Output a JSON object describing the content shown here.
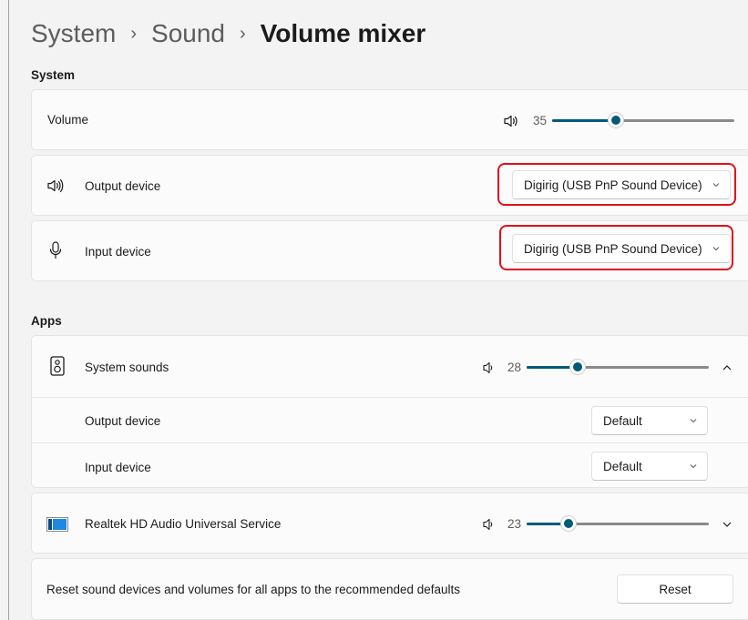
{
  "breadcrumb": {
    "items": [
      "System",
      "Sound"
    ],
    "separator": "›",
    "current": "Volume mixer"
  },
  "system_section": {
    "label": "System",
    "volume": {
      "label": "Volume",
      "value": "35",
      "level": 35,
      "icon": "speaker-icon"
    },
    "output_device": {
      "label": "Output device",
      "selected": "Digirig (USB PnP Sound Device)",
      "icon": "speaker-icon"
    },
    "input_device": {
      "label": "Input device",
      "selected": "Digirig (USB PnP Sound Device)",
      "icon": "microphone-icon"
    }
  },
  "apps_section": {
    "label": "Apps",
    "apps": [
      {
        "name": "System sounds",
        "icon": "system-sounds-icon",
        "volume": "28",
        "level": 28,
        "expanded": true,
        "output_device": {
          "label": "Output device",
          "selected": "Default"
        },
        "input_device": {
          "label": "Input device",
          "selected": "Default"
        }
      },
      {
        "name": "Realtek HD Audio Universal Service",
        "icon": "realtek-app-icon",
        "volume": "23",
        "level": 23,
        "expanded": false
      }
    ]
  },
  "reset": {
    "text": "Reset sound devices and volumes for all apps to the recommended defaults",
    "button_label": "Reset"
  },
  "colors": {
    "accent": "#005a78",
    "highlight": "#e0101a",
    "background": "#f3f3f3",
    "card": "#fbfbfb"
  }
}
